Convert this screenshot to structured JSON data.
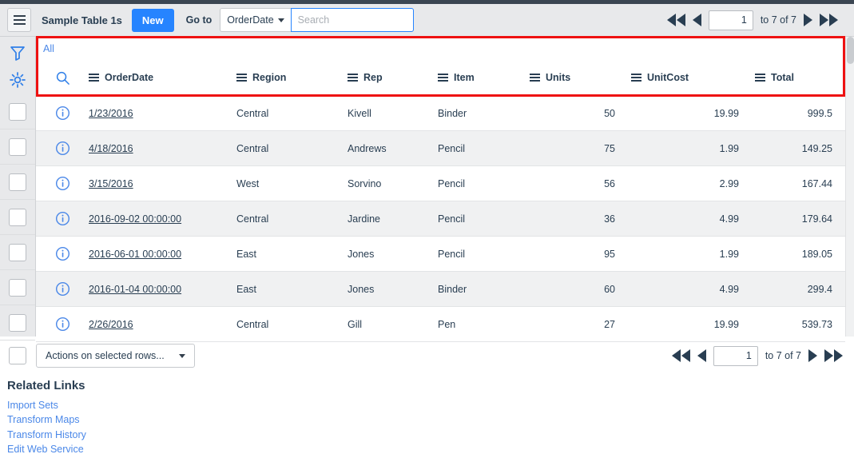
{
  "header": {
    "menu_icon": "hamburger-icon",
    "title": "Sample Table 1s",
    "new_label": "New",
    "goto_label": "Go to",
    "goto_field": "OrderDate",
    "search_value": "",
    "search_placeholder": "Search"
  },
  "pagination": {
    "first_icon": "double-left-arrow-icon",
    "prev_icon": "left-arrow-icon",
    "page_value": "1",
    "range_text": "to 7 of 7",
    "next_icon": "right-arrow-icon",
    "last_icon": "double-right-arrow-icon"
  },
  "rail": {
    "filter_icon": "funnel-icon",
    "settings_icon": "gear-icon"
  },
  "list": {
    "breadcrumb": "All",
    "search_row_icon": "magnifier-icon",
    "columns": [
      {
        "label": "OrderDate"
      },
      {
        "label": "Region"
      },
      {
        "label": "Rep"
      },
      {
        "label": "Item"
      },
      {
        "label": "Units"
      },
      {
        "label": "UnitCost"
      },
      {
        "label": "Total"
      }
    ],
    "rows": [
      {
        "order_date": "1/23/2016",
        "region": "Central",
        "rep": "Kivell",
        "item": "Binder",
        "units": "50",
        "unit_cost": "19.99",
        "total": "999.5"
      },
      {
        "order_date": "4/18/2016",
        "region": "Central",
        "rep": "Andrews",
        "item": "Pencil",
        "units": "75",
        "unit_cost": "1.99",
        "total": "149.25"
      },
      {
        "order_date": "3/15/2016",
        "region": "West",
        "rep": "Sorvino",
        "item": "Pencil",
        "units": "56",
        "unit_cost": "2.99",
        "total": "167.44"
      },
      {
        "order_date": "2016-09-02 00:00:00",
        "region": "Central",
        "rep": "Jardine",
        "item": "Pencil",
        "units": "36",
        "unit_cost": "4.99",
        "total": "179.64"
      },
      {
        "order_date": "2016-06-01 00:00:00",
        "region": "East",
        "rep": "Jones",
        "item": "Pencil",
        "units": "95",
        "unit_cost": "1.99",
        "total": "189.05"
      },
      {
        "order_date": "2016-01-04 00:00:00",
        "region": "East",
        "rep": "Jones",
        "item": "Binder",
        "units": "60",
        "unit_cost": "4.99",
        "total": "299.4"
      },
      {
        "order_date": "2/26/2016",
        "region": "Central",
        "rep": "Gill",
        "item": "Pen",
        "units": "27",
        "unit_cost": "19.99",
        "total": "539.73"
      }
    ]
  },
  "footer": {
    "actions_label": "Actions on selected rows..."
  },
  "related": {
    "title": "Related Links",
    "links": [
      {
        "label": "Import Sets"
      },
      {
        "label": "Transform Maps"
      },
      {
        "label": "Transform History"
      },
      {
        "label": "Edit Web Service"
      }
    ]
  },
  "colors": {
    "accent_blue": "#2684ff",
    "link_blue": "#4b88e8",
    "text_dark": "#293e52",
    "highlight_red": "#ee1111"
  }
}
